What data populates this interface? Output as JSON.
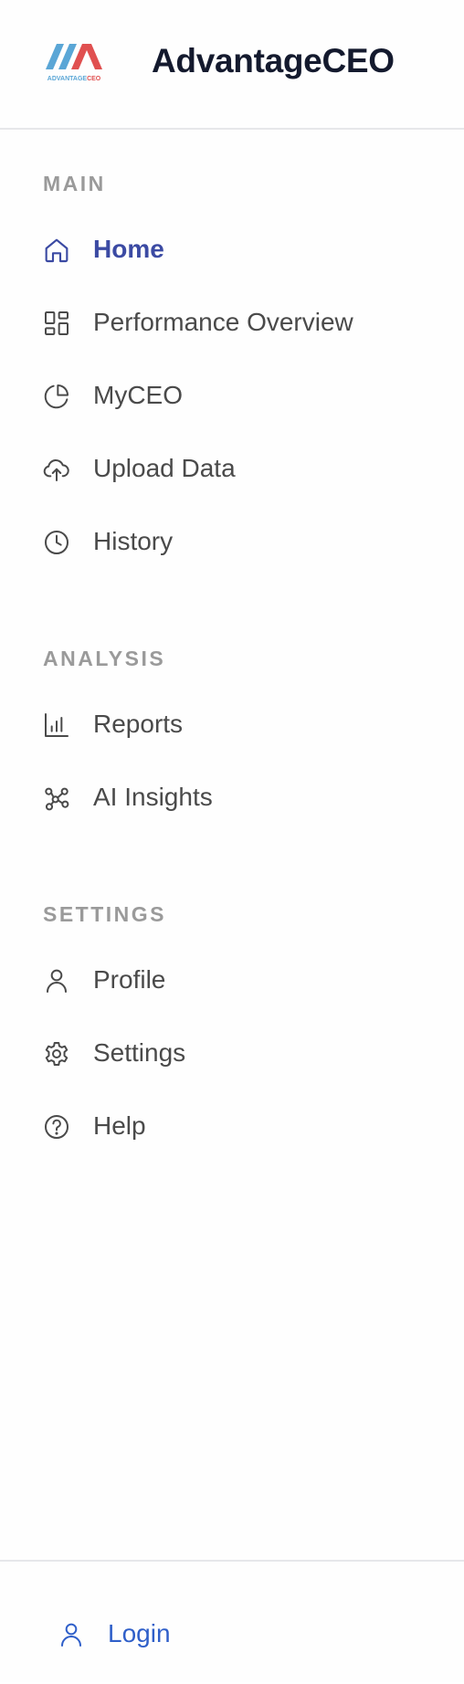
{
  "brand": {
    "name": "AdvantageCEO",
    "logo_text": "ADVANTAGECEO"
  },
  "sections": {
    "main": "MAIN",
    "analysis": "ANALYSIS",
    "settings": "SETTINGS"
  },
  "nav": {
    "home": "Home",
    "performance_overview": "Performance Overview",
    "myceo": "MyCEO",
    "upload_data": "Upload Data",
    "history": "History",
    "reports": "Reports",
    "ai_insights": "AI Insights",
    "profile": "Profile",
    "settings": "Settings",
    "help": "Help"
  },
  "footer": {
    "login": "Login"
  },
  "active_item": "home",
  "colors": {
    "active": "#3b4aa3",
    "text": "#4a4a4a",
    "section_label": "#9a9a9a",
    "login": "#2f5fc9",
    "brand": "#141a2e",
    "logo_blue": "#5aa6d6",
    "logo_red": "#e05050"
  },
  "icons": {
    "home": "home-icon",
    "performance_overview": "dashboard-grid-icon",
    "myceo": "pie-chart-icon",
    "upload_data": "cloud-upload-icon",
    "history": "clock-icon",
    "reports": "bar-chart-icon",
    "ai_insights": "nodes-icon",
    "profile": "user-icon",
    "settings": "gear-icon",
    "help": "help-circle-icon",
    "login": "user-icon"
  }
}
